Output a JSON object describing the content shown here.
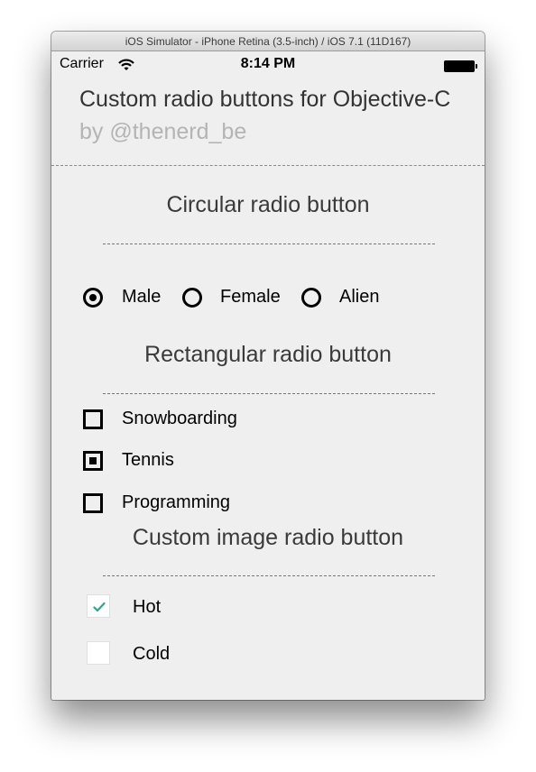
{
  "window": {
    "title": "iOS Simulator - iPhone Retina (3.5-inch) / iOS 7.1 (11D167)"
  },
  "status_bar": {
    "carrier": "Carrier",
    "time": "8:14 PM",
    "icons": [
      "wifi-icon",
      "battery-icon"
    ]
  },
  "header": {
    "title": "Custom radio buttons for Objective-C",
    "subtitle": "by @thenerd_be"
  },
  "sections": {
    "circular": {
      "title": "Circular radio button",
      "options": [
        {
          "label": "Male",
          "selected": true
        },
        {
          "label": "Female",
          "selected": false
        },
        {
          "label": "Alien",
          "selected": false
        }
      ]
    },
    "rectangular": {
      "title": "Rectangular radio button",
      "options": [
        {
          "label": "Snowboarding",
          "selected": false
        },
        {
          "label": "Tennis",
          "selected": true
        },
        {
          "label": "Programming",
          "selected": false
        }
      ]
    },
    "image": {
      "title": "Custom image radio button",
      "options": [
        {
          "label": "Hot",
          "selected": true
        },
        {
          "label": "Cold",
          "selected": false
        }
      ]
    }
  },
  "colors": {
    "background": "#efeff0",
    "title_text": "#333333",
    "subtitle_text": "#b4b4b4",
    "check_accent": "#2aa68f"
  }
}
